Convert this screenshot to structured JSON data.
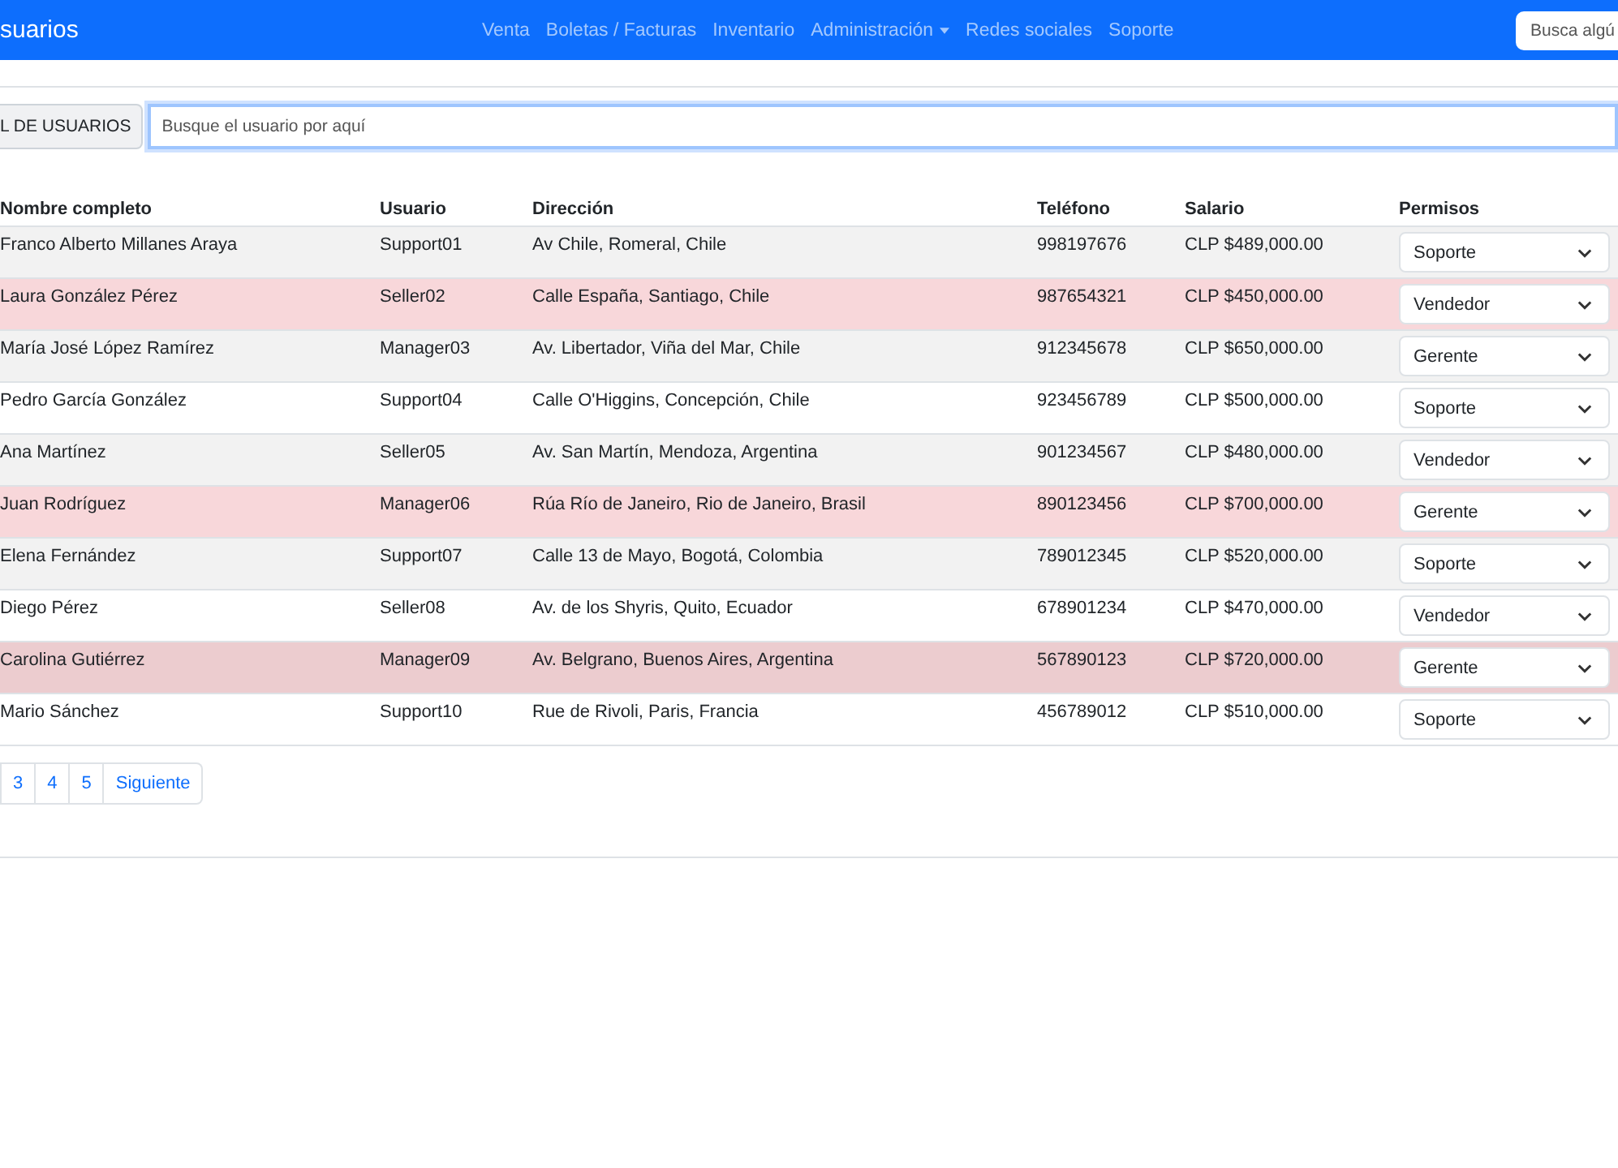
{
  "navbar": {
    "brand": "suarios",
    "links": [
      {
        "label": "Venta",
        "kind": "link"
      },
      {
        "label": "Boletas / Facturas",
        "kind": "link"
      },
      {
        "label": "Inventario",
        "kind": "link"
      },
      {
        "label": "Administración",
        "kind": "dropdown"
      },
      {
        "label": "Redes sociales",
        "kind": "link"
      },
      {
        "label": "Soporte",
        "kind": "link"
      }
    ],
    "search": {
      "placeholder": "Busca algú"
    }
  },
  "search_group": {
    "label": "L DE USUARIOS",
    "placeholder": "Busque el usuario por aquí"
  },
  "table": {
    "columns": [
      "Nombre completo",
      "Usuario",
      "Dirección",
      "Teléfono",
      "Salario",
      "Permisos"
    ],
    "rows": [
      {
        "color": "#f2f2f2",
        "cells": [
          "Franco Alberto Millanes Araya",
          "Support01",
          "Av Chile, Romeral, Chile",
          "998197676",
          "CLP $489,000.00"
        ],
        "permission": "Soporte"
      },
      {
        "color": "#f8d7da",
        "cells": [
          "Laura González Pérez",
          "Seller02",
          "Calle España, Santiago, Chile",
          "987654321",
          "CLP $450,000.00"
        ],
        "permission": "Vendedor"
      },
      {
        "color": "#f2f2f2",
        "cells": [
          "María José López Ramírez",
          "Manager03",
          "Av. Libertador, Viña del Mar, Chile",
          "912345678",
          "CLP $650,000.00"
        ],
        "permission": "Gerente"
      },
      {
        "color": "#ffffff",
        "cells": [
          "Pedro García González",
          "Support04",
          "Calle O'Higgins, Concepción, Chile",
          "923456789",
          "CLP $500,000.00"
        ],
        "permission": "Soporte"
      },
      {
        "color": "#f2f2f2",
        "cells": [
          "Ana Martínez",
          "Seller05",
          "Av. San Martín, Mendoza, Argentina",
          "901234567",
          "CLP $480,000.00"
        ],
        "permission": "Vendedor"
      },
      {
        "color": "#f8d7da",
        "cells": [
          "Juan Rodríguez",
          "Manager06",
          "Rúa Río de Janeiro, Rio de Janeiro, Brasil",
          "890123456",
          "CLP $700,000.00"
        ],
        "permission": "Gerente"
      },
      {
        "color": "#f2f2f2",
        "cells": [
          "Elena Fernández",
          "Support07",
          "Calle 13 de Mayo, Bogotá, Colombia",
          "789012345",
          "CLP $520,000.00"
        ],
        "permission": "Soporte"
      },
      {
        "color": "#ffffff",
        "cells": [
          "Diego Pérez",
          "Seller08",
          "Av. de los Shyris, Quito, Ecuador",
          "678901234",
          "CLP $470,000.00"
        ],
        "permission": "Vendedor"
      },
      {
        "color": "#eccccf",
        "cells": [
          "Carolina Gutiérrez",
          "Manager09",
          "Av. Belgrano, Buenos Aires, Argentina",
          "567890123",
          "CLP $720,000.00"
        ],
        "permission": "Gerente"
      },
      {
        "color": "#ffffff",
        "cells": [
          "Mario Sánchez",
          "Support10",
          "Rue de Rivoli, Paris, Francia",
          "456789012",
          "CLP $510,000.00"
        ],
        "permission": "Soporte"
      }
    ]
  },
  "pagination": [
    "3",
    "4",
    "5",
    "Siguiente"
  ]
}
